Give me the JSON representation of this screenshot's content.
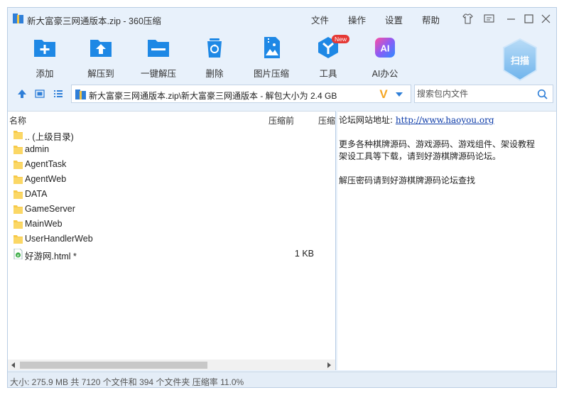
{
  "window": {
    "title": "新大富豪三网通版本.zip - 360压缩",
    "menu": [
      "文件",
      "操作",
      "设置",
      "帮助"
    ]
  },
  "toolbar": {
    "items": [
      {
        "label": "添加",
        "icon": "add-icon"
      },
      {
        "label": "解压到",
        "icon": "extract-to-icon"
      },
      {
        "label": "一键解压",
        "icon": "one-click-extract-icon"
      },
      {
        "label": "删除",
        "icon": "delete-icon"
      },
      {
        "label": "图片压缩",
        "icon": "image-compress-icon"
      },
      {
        "label": "工具",
        "icon": "tools-icon",
        "badge": "New"
      },
      {
        "label": "AI办公",
        "icon": "ai-office-icon",
        "glyph": "AI"
      }
    ],
    "scan_label": "扫描"
  },
  "address": {
    "path": "新大富豪三网通版本.zip\\新大富豪三网通版本 - 解包大小为 2.4 GB",
    "v_mark": "V"
  },
  "search": {
    "placeholder": "搜索包内文件"
  },
  "list": {
    "columns": [
      "名称",
      "压缩前",
      "压缩"
    ],
    "rows": [
      {
        "name": ".. (上级目录)",
        "size": "",
        "type": "folder"
      },
      {
        "name": "admin",
        "size": "",
        "type": "folder"
      },
      {
        "name": "AgentTask",
        "size": "",
        "type": "folder"
      },
      {
        "name": "AgentWeb",
        "size": "",
        "type": "folder"
      },
      {
        "name": "DATA",
        "size": "",
        "type": "folder"
      },
      {
        "name": "GameServer",
        "size": "",
        "type": "folder"
      },
      {
        "name": "MainWeb",
        "size": "",
        "type": "folder"
      },
      {
        "name": "UserHandlerWeb",
        "size": "",
        "type": "folder"
      },
      {
        "name": "好游网.html *",
        "size": "1 KB",
        "type": "html"
      }
    ]
  },
  "comment": {
    "line1_label": "论坛网站地址:",
    "line1_link": "http://www.haoyou.org",
    "line2": "更多各种棋牌源码、游戏源码、游戏组件、架设教程",
    "line3": "架设工具等下载，请到好游棋牌源码论坛。",
    "line4": "解压密码请到好游棋牌源码论坛查找"
  },
  "status": {
    "text": "大小: 275.9 MB 共 7120 个文件和 394 个文件夹 压缩率 11.0%"
  },
  "colors": {
    "accent": "#1e88e5",
    "folder": "#f7c948",
    "background": "#e8f1fb"
  }
}
